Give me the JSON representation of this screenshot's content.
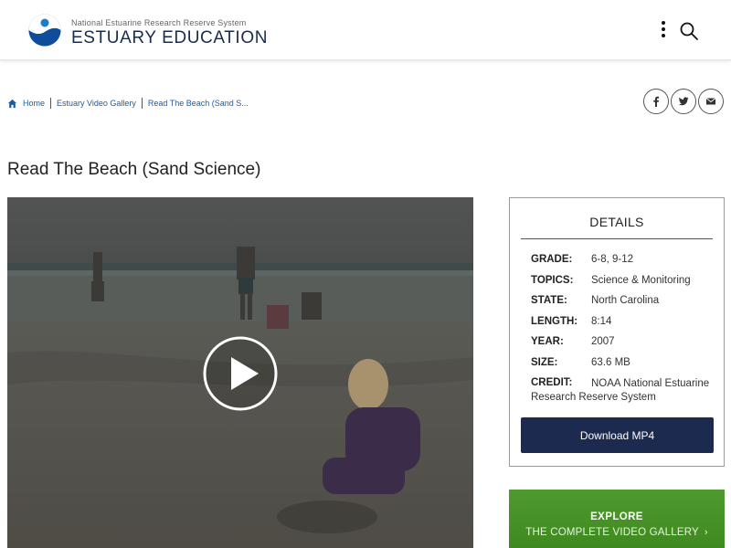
{
  "header": {
    "org_name": "National Estuarine Research Reserve System",
    "site_title": "ESTUARY EDUCATION",
    "menu_icon": "vertical-ellipsis-icon",
    "search_icon": "search-icon"
  },
  "breadcrumb": {
    "items": [
      "Home",
      "Estuary Video Gallery",
      "Read The Beach (Sand S..."
    ]
  },
  "share": {
    "icons": [
      "facebook-icon",
      "twitter-icon",
      "email-icon"
    ]
  },
  "page": {
    "title": "Read The Beach (Sand Science)"
  },
  "details": {
    "heading": "DETAILS",
    "fields": [
      {
        "label": "GRADE:",
        "value": "6-8, 9-12"
      },
      {
        "label": "TOPICS:",
        "value": "Science & Monitoring"
      },
      {
        "label": "STATE:",
        "value": "North Carolina"
      },
      {
        "label": "LENGTH:",
        "value": "8:14"
      },
      {
        "label": "YEAR:",
        "value": "2007"
      },
      {
        "label": "SIZE:",
        "value": "63.6 MB"
      }
    ],
    "credit_label": "CREDIT:",
    "credit_value": "NOAA National Estuarine Research Reserve System",
    "download_label": "Download MP4"
  },
  "explore": {
    "title": "EXPLORE",
    "subtitle": "THE COMPLETE VIDEO GALLERY"
  },
  "colors": {
    "navy": "#1c2a4f",
    "link": "#1f5a9a",
    "green": "#4a9629"
  }
}
